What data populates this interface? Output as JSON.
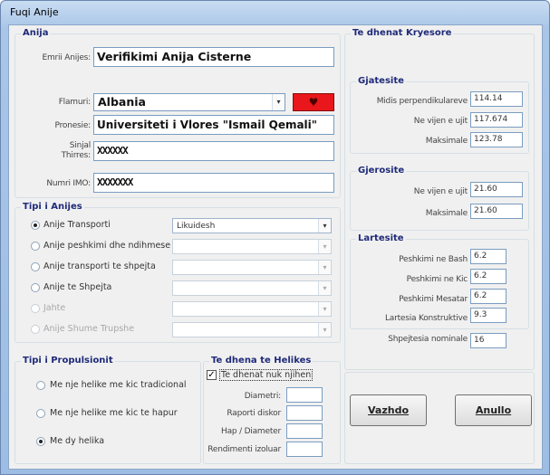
{
  "window": {
    "title": "Fuqi Anije"
  },
  "anija": {
    "legend": "Anija",
    "emri_label": "Emrii Anijes:",
    "emri_value": "Verifikimi Anija Cisterne",
    "flamuri_label": "Flamuri:",
    "flamuri_value": "Albania",
    "flag_icon": "heart-icon",
    "pronesie_label": "Pronesie:",
    "pronesie_value": "Universiteti i Vlores \"Ismail Qemali\"",
    "sinjal_label_1": "Sinjal",
    "sinjal_label_2": "Thirres:",
    "sinjal_value": "XXXXXX",
    "imo_label": "Numri IMO:",
    "imo_value": "XXXXXXX"
  },
  "tipi_anijes": {
    "legend": "Tipi i Anijes",
    "options": [
      {
        "label": "Anije Transporti",
        "combo": "Likuidesh",
        "selected": true,
        "enabled": true
      },
      {
        "label": "Anije peshkimi dhe ndihmese",
        "combo": "",
        "selected": false,
        "enabled": true
      },
      {
        "label": "Anije transporti te shpejta",
        "combo": "",
        "selected": false,
        "enabled": true
      },
      {
        "label": "Anije te Shpejta",
        "combo": "",
        "selected": false,
        "enabled": true
      },
      {
        "label": "Jahte",
        "combo": "",
        "selected": false,
        "enabled": false
      },
      {
        "label": "Anije Shume Trupshe",
        "combo": "",
        "selected": false,
        "enabled": false
      }
    ]
  },
  "propulsion": {
    "legend": "Tipi i Propulsionit",
    "options": [
      {
        "label": "Me nje helike me kic tradicional",
        "selected": false
      },
      {
        "label": "Me nje helike me kic te hapur",
        "selected": false
      },
      {
        "label": "Me dy helika",
        "selected": true
      }
    ]
  },
  "helikes": {
    "legend": "Te dhena te Helikes",
    "checkbox_label": "Te dhenat nuk njihen",
    "checked": true,
    "diametri_label": "Diametri:",
    "raporti_label": "Raporti diskor",
    "hap_label": "Hap / Diameter",
    "rendimenti_label": "Rendimenti izoluar"
  },
  "kryesore": {
    "legend": "Te dhenat Kryesore",
    "gjatesite": {
      "legend": "Gjatesite",
      "rows": [
        {
          "label": "Midis perpendikulareve",
          "value": "114.14"
        },
        {
          "label": "Ne vijen e ujit",
          "value": "117.674"
        },
        {
          "label": "Maksimale",
          "value": "123.78"
        }
      ]
    },
    "gjerosite": {
      "legend": "Gjerosite",
      "rows": [
        {
          "label": "Ne vijen e ujit",
          "value": "21.60"
        },
        {
          "label": "Maksimale",
          "value": "21.60"
        }
      ]
    },
    "lartesite": {
      "legend": "Lartesite",
      "rows": [
        {
          "label": "Peshkimi ne Bash",
          "value": "6.2"
        },
        {
          "label": "Peshkimi ne Kic",
          "value": "6.2"
        },
        {
          "label": "Peshkimi Mesatar",
          "value": "6.2"
        },
        {
          "label": "Lartesia Konstruktive",
          "value": "9.3"
        }
      ]
    },
    "shpejtesia_label": "Shpejtesia nominale",
    "shpejtesia_value": "16"
  },
  "buttons": {
    "vazhdo": "Vazhdo",
    "anullo": "Anullo"
  }
}
